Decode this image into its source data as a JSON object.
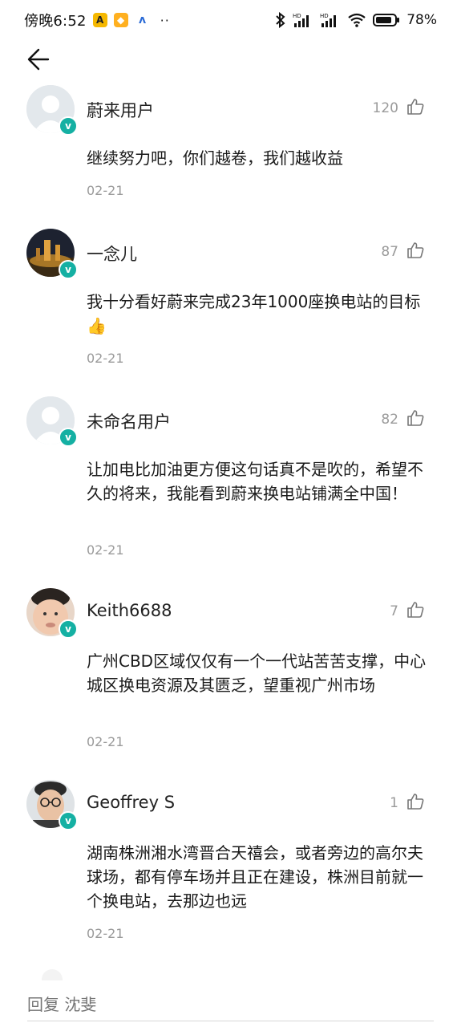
{
  "status_bar": {
    "time": "傍晚6:52",
    "notif_a": "A",
    "notif_b": "◆",
    "notif_c": "ʌ",
    "more": "··",
    "battery": "78%"
  },
  "comments": [
    {
      "name": "蔚来用户",
      "likes": "120",
      "text": "继续努力吧，你们越卷，我们越收益",
      "date": "02-21",
      "avatar": "default"
    },
    {
      "name": "一念儿",
      "likes": "87",
      "text": "我十分看好蔚来完成23年1000座换电站的目标👍",
      "date": "02-21",
      "avatar": "night"
    },
    {
      "name": "未命名用户",
      "likes": "82",
      "text": "让加电比加油更方便这句话真不是吹的，希望不久的将来，我能看到蔚来换电站铺满全中国！",
      "date": "02-21",
      "avatar": "default"
    },
    {
      "name": "Keith6688",
      "likes": "7",
      "text": "广州CBD区域仅仅有一个一代站苦苦支撑，中心城区换电资源及其匮乏，望重视广州市场",
      "date": "02-21",
      "avatar": "face"
    },
    {
      "name": "Geoffrey S",
      "likes": "1",
      "text": "湖南株洲湘水湾晋合天禧会，或者旁边的高尔夫球场，都有停车场并且正在建设，株洲目前就一个换电站，去那边也远",
      "date": "02-21",
      "avatar": "glasses"
    }
  ],
  "reply": {
    "placeholder": "回复 沈斐"
  },
  "verified_mark": "v",
  "colors": {
    "verified": "#15b0a3",
    "muted": "#9a9a9a"
  }
}
